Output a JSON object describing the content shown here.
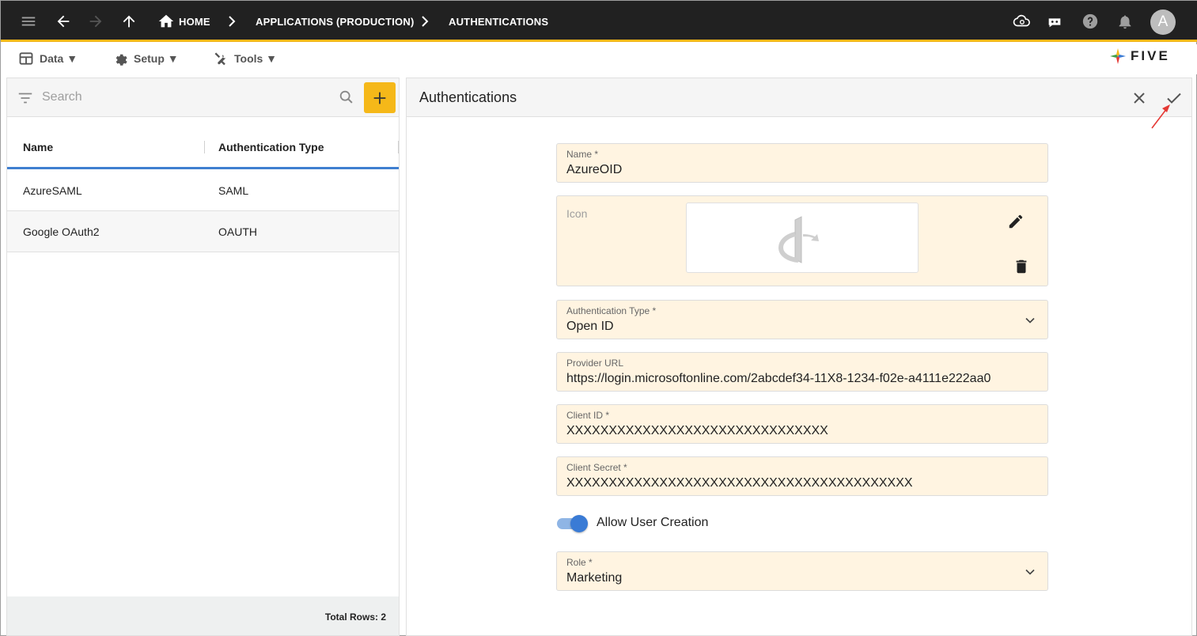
{
  "topbar": {
    "breadcrumbs": [
      "HOME",
      "APPLICATIONS (PRODUCTION)",
      "AUTHENTICATIONS"
    ],
    "avatar_letter": "A"
  },
  "menu": {
    "data_label": "Data ▼",
    "setup_label": "Setup ▼",
    "tools_label": "Tools ▼",
    "logo_text": "FIVE"
  },
  "list": {
    "search_placeholder": "Search",
    "columns": [
      "Name",
      "Authentication Type"
    ],
    "rows": [
      {
        "name": "AzureSAML",
        "type": "SAML"
      },
      {
        "name": "Google OAuth2",
        "type": "OAUTH"
      }
    ],
    "total_rows": "Total Rows: 2"
  },
  "form": {
    "title": "Authentications",
    "name_label": "Name *",
    "name_value": "AzureOID",
    "icon_label": "Icon",
    "auth_type_label": "Authentication Type *",
    "auth_type_value": "Open ID",
    "provider_url_label": "Provider URL",
    "provider_url_value": "https://login.microsoftonline.com/2abcdef34-11X8-1234-f02e-a4111e222aa0",
    "client_id_label": "Client ID *",
    "client_id_value": "XXXXXXXXXXXXXXXXXXXXXXXXXXXXXXX",
    "client_secret_label": "Client Secret *",
    "client_secret_value": "XXXXXXXXXXXXXXXXXXXXXXXXXXXXXXXXXXXXXXXXX",
    "allow_user_creation_label": "Allow User Creation",
    "allow_user_creation": true,
    "role_label": "Role *",
    "role_value": "Marketing"
  },
  "colors": {
    "accent": "#f5b819",
    "topbar": "#212121",
    "field_bg": "#fff4e1",
    "toggle": "#3a7bd5",
    "annotation": "#e53935"
  }
}
